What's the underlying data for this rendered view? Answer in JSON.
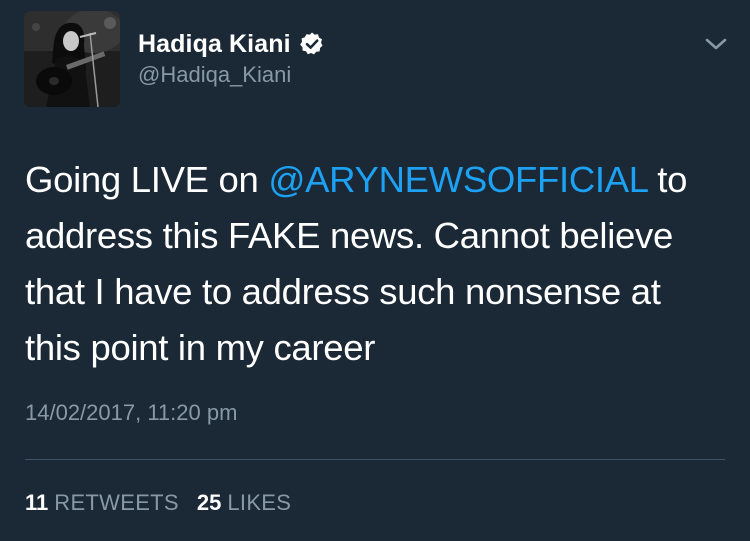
{
  "tweet": {
    "display_name": "Hadiqa Kiani",
    "handle": "@Hadiqa_Kiani",
    "text_before": "Going LIVE on ",
    "mention": "@ARYNEWSOFFICIAL",
    "text_after": " to address this FAKE news. Cannot believe that I have to address such nonsense at this point in my career",
    "timestamp": "14/02/2017, 11:20 pm",
    "retweets_count": "11",
    "retweets_label": "RETWEETS",
    "likes_count": "25",
    "likes_label": "LIKES"
  },
  "icons": {
    "verified": "verified-badge-icon",
    "chevron": "chevron-down-icon"
  },
  "colors": {
    "background": "#1b2836",
    "text": "#ffffff",
    "secondary": "#8899a6",
    "mention": "#1da1f2",
    "divider": "#3d5466"
  }
}
